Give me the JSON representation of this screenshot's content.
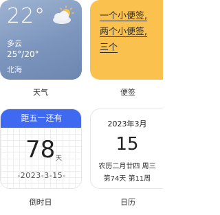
{
  "weather": {
    "temperature": "22°",
    "condition": "多云",
    "range": "25°/20°",
    "city": "北海",
    "icon": "partly-cloudy-icon",
    "label": "天气"
  },
  "notes": {
    "lines": [
      "一个小便签,",
      "两个小便签,",
      "三个"
    ],
    "label": "便签"
  },
  "countdown": {
    "header": "距五一还有",
    "days": "78",
    "unit": "天",
    "date": "-2023-3-15-",
    "label": "倒时日"
  },
  "calendar": {
    "month": "2023年3月",
    "day": "15",
    "lunar": "农历二月廿四  周三",
    "week": "第74天 第11周",
    "label": "日历"
  },
  "colors": {
    "weather_bg": "#7c95bd",
    "notes_bg": "#fbc14e",
    "countdown_header": "#3f69f0"
  }
}
